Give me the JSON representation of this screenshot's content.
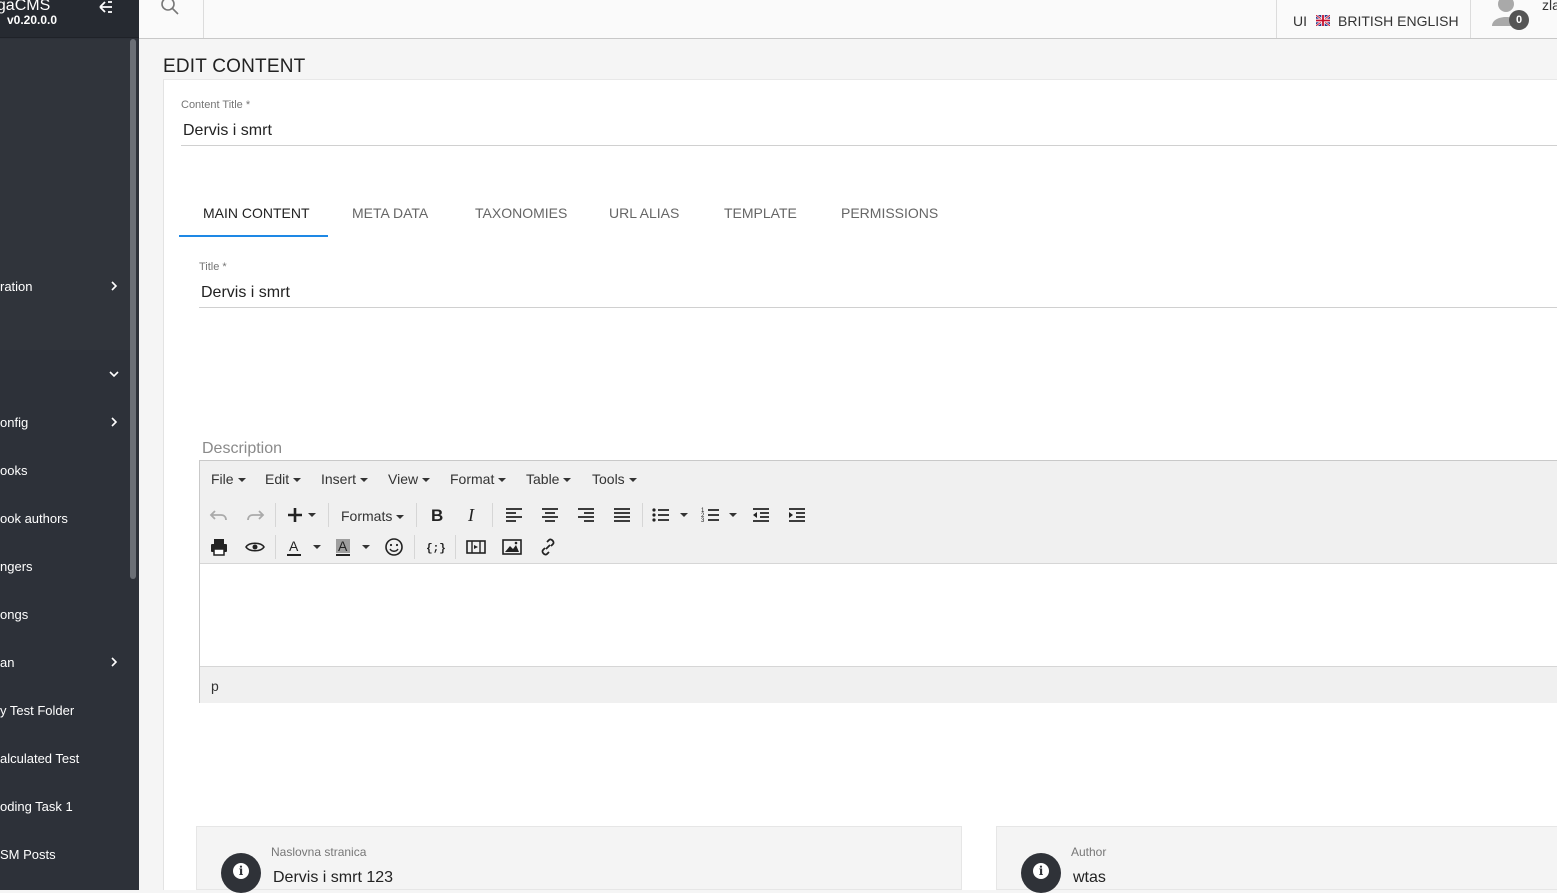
{
  "app": {
    "brand_name": "egaCMS",
    "version": "v0.20.0.0"
  },
  "sidebar": {
    "items": [
      {
        "label": "ration",
        "has_chevron": "right"
      },
      {
        "label": "",
        "has_chevron": "down"
      },
      {
        "label": "onfig",
        "has_chevron": "right"
      },
      {
        "label": "ooks"
      },
      {
        "label": "ook authors"
      },
      {
        "label": "ngers"
      },
      {
        "label": "ongs"
      },
      {
        "label": "an",
        "has_chevron": "right"
      },
      {
        "label": "y Test Folder"
      },
      {
        "label": "alculated Test"
      },
      {
        "label": "oding Task 1"
      },
      {
        "label": "SM Posts"
      }
    ]
  },
  "header": {
    "ui_label": "UI",
    "language": "BRITISH ENGLISH",
    "notifications": "0",
    "user": "zla"
  },
  "page": {
    "title": "EDIT CONTENT"
  },
  "content_title": {
    "label": "Content Title *",
    "value": "Dervis i smrt"
  },
  "tabs": [
    {
      "label": "MAIN CONTENT",
      "active": true
    },
    {
      "label": "META DATA"
    },
    {
      "label": "TAXONOMIES"
    },
    {
      "label": "URL ALIAS"
    },
    {
      "label": "TEMPLATE"
    },
    {
      "label": "PERMISSIONS"
    }
  ],
  "title_field": {
    "label": "Title *",
    "value": "Dervis i smrt"
  },
  "description": {
    "label": "Description",
    "menu": [
      "File",
      "Edit",
      "Insert",
      "View",
      "Format",
      "Table",
      "Tools"
    ],
    "formats_label": "Formats",
    "status_path": "p"
  },
  "info_cards": [
    {
      "label": "Naslovna stranica",
      "value": "Dervis i smrt 123"
    },
    {
      "label": "Author",
      "value": "wtas"
    }
  ],
  "colors": {
    "sidebar_bg": "#2d3139",
    "accent": "#1e88e5"
  }
}
